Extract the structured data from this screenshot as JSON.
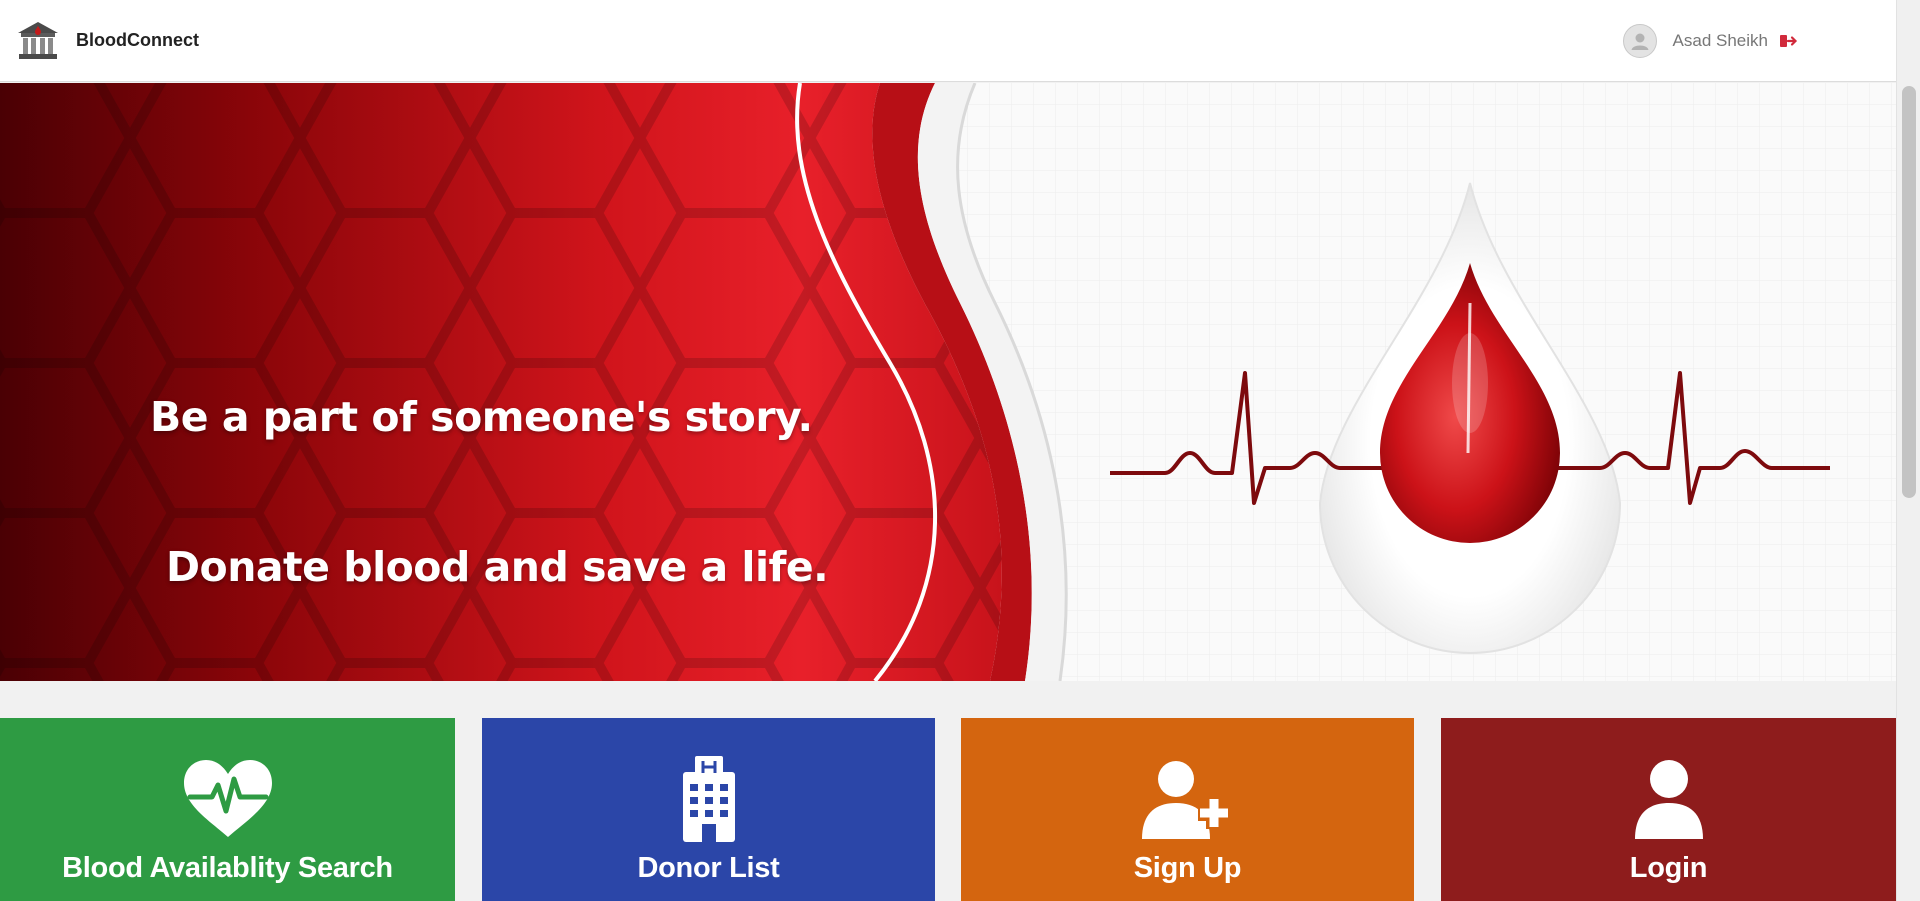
{
  "header": {
    "brand_name": "BloodConnect",
    "logo_icon": "blood-bank-building-icon",
    "user_name": "Asad Sheikh",
    "avatar_icon": "user-avatar-icon",
    "logout_icon": "logout-icon"
  },
  "hero": {
    "line1": "Be a part of someone's story.",
    "line2": "Donate blood and save a life.",
    "illustration_icon": "blood-drop-heartbeat-icon"
  },
  "tiles": [
    {
      "label": "Blood Availablity Search",
      "icon": "heart-pulse-icon",
      "color": "#2e9b43"
    },
    {
      "label": "Donor List",
      "icon": "hospital-building-icon",
      "color": "#2b46a8"
    },
    {
      "label": "Sign Up",
      "icon": "user-plus-icon",
      "color": "#d4650f"
    },
    {
      "label": "Login",
      "icon": "user-icon",
      "color": "#8e1c1c"
    }
  ],
  "colors": {
    "brand_red": "#d8181f",
    "dark_red": "#5a0006"
  }
}
